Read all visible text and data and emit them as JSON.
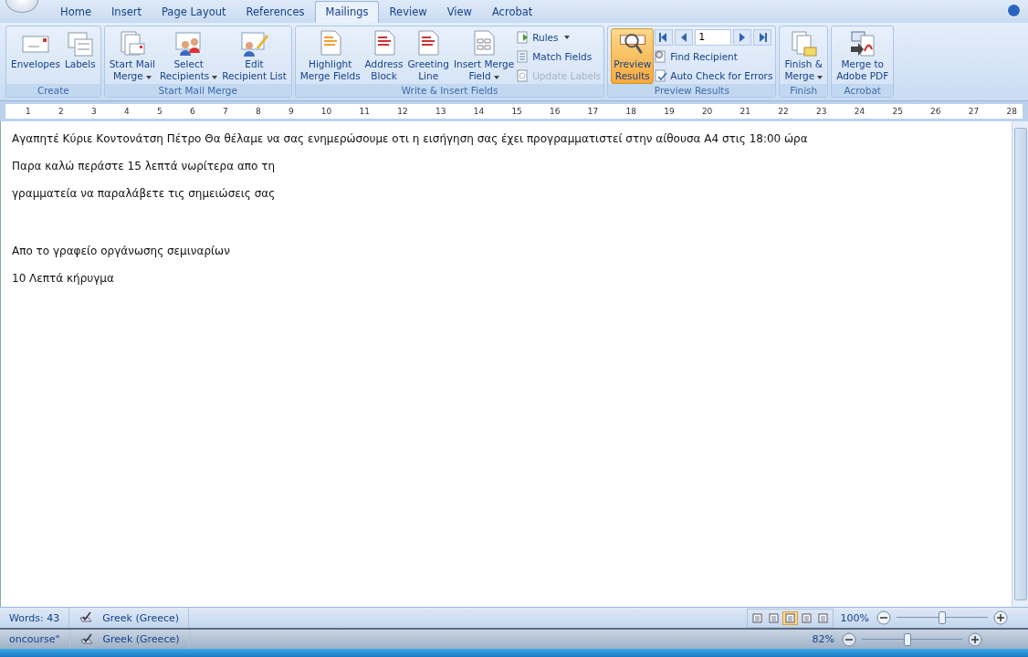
{
  "tabs": [
    {
      "label": "Home",
      "selected": false
    },
    {
      "label": "Insert",
      "selected": false
    },
    {
      "label": "Page Layout",
      "selected": false
    },
    {
      "label": "References",
      "selected": false
    },
    {
      "label": "Mailings",
      "selected": true
    },
    {
      "label": "Review",
      "selected": false
    },
    {
      "label": "View",
      "selected": false
    },
    {
      "label": "Acrobat",
      "selected": false
    }
  ],
  "groups": [
    {
      "label": "Create",
      "items": [
        {
          "kind": "large",
          "label": "Envelopes",
          "dropdown": false
        },
        {
          "kind": "large",
          "label": "Labels",
          "dropdown": false
        }
      ]
    },
    {
      "label": "Start Mail Merge",
      "items": [
        {
          "kind": "large",
          "label": "Start Mail\nMerge",
          "dropdown": true
        },
        {
          "kind": "large",
          "label": "Select\nRecipients",
          "dropdown": true
        },
        {
          "kind": "large",
          "label": "Edit\nRecipient List",
          "dropdown": false
        }
      ]
    },
    {
      "label": "Write & Insert Fields",
      "items": [
        {
          "kind": "large",
          "label": "Highlight\nMerge Fields",
          "dropdown": false
        },
        {
          "kind": "large",
          "label": "Address\nBlock",
          "dropdown": false
        },
        {
          "kind": "large",
          "label": "Greeting\nLine",
          "dropdown": false
        },
        {
          "kind": "large",
          "label": "Insert Merge\nField",
          "dropdown": true
        },
        {
          "kind": "small",
          "label": "Rules",
          "dropdown": true,
          "disabled": false
        },
        {
          "kind": "small",
          "label": "Match Fields",
          "dropdown": false,
          "disabled": false
        },
        {
          "kind": "small",
          "label": "Update Labels",
          "dropdown": false,
          "disabled": true
        }
      ]
    },
    {
      "label": "Preview Results",
      "items": [
        {
          "kind": "large",
          "label": "Preview\nResults",
          "dropdown": false,
          "active": true
        },
        {
          "kind": "nav",
          "value": "1"
        },
        {
          "kind": "small",
          "label": "Find Recipient",
          "dropdown": false,
          "disabled": false
        },
        {
          "kind": "small",
          "label": "Auto Check for Errors",
          "dropdown": false,
          "disabled": false
        }
      ]
    },
    {
      "label": "Finish",
      "items": [
        {
          "kind": "large",
          "label": "Finish &\nMerge",
          "dropdown": true
        }
      ]
    },
    {
      "label": "Acrobat",
      "items": [
        {
          "kind": "large",
          "label": "Merge to\nAdobe PDF",
          "dropdown": false
        }
      ]
    }
  ],
  "ruler": [
    "1",
    "2",
    "3",
    "4",
    "5",
    "6",
    "7",
    "8",
    "9",
    "10",
    "11",
    "12",
    "13",
    "14",
    "15",
    "16",
    "17",
    "18",
    "19",
    "20",
    "21",
    "22",
    "23",
    "24",
    "25",
    "26",
    "27",
    "28"
  ],
  "paragraphs": [
    {
      "text": "Αγαπητέ Κύριε Κοντονάτση Πέτρο Θα θέλαμε να σας ενημερώσουμε οτι η εισήγηση σας έχει προγραμματιστεί στην αίθουσα Α4 στις 18:00 ώρα",
      "gap_before": false
    },
    {
      "text": "Παρα καλώ περάστε 15 λεπτά νωρίτερα απο τη",
      "gap_before": false
    },
    {
      "text": "γραμματεία να παραλάβετε τις σημειώσεις σας",
      "gap_before": false
    },
    {
      "text": "Απο το γραφείο οργάνωσης σεμιναρίων",
      "gap_before": true
    },
    {
      "text": "10 Λεπτά κήρυγμα",
      "gap_before": false
    }
  ],
  "status_bar": {
    "words": "Words: 43",
    "language": "Greek (Greece)",
    "views": [
      {
        "selected": false
      },
      {
        "selected": false
      },
      {
        "selected": true
      },
      {
        "selected": false
      },
      {
        "selected": false
      }
    ],
    "zoom": "100%",
    "zoom_slider": {
      "level": 0.5
    }
  },
  "back_status_bar": {
    "title": "oncourse\"",
    "language": "Greek (Greece)",
    "zoom": "82%",
    "zoom_slider": {
      "level": 0.45
    }
  }
}
